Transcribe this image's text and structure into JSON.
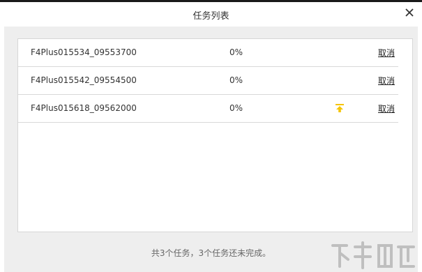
{
  "dialog": {
    "title": "任务列表",
    "footer": "共3个任务，3个任务还未完成。"
  },
  "tasks": [
    {
      "name": "F4Plus015534_09553700",
      "progress": "0%",
      "cancel_label": "取消",
      "show_top_icon": false
    },
    {
      "name": "F4Plus015542_09554500",
      "progress": "0%",
      "cancel_label": "取消",
      "show_top_icon": false
    },
    {
      "name": "F4Plus015618_09562000",
      "progress": "0%",
      "cancel_label": "取消",
      "show_top_icon": true
    }
  ],
  "colors": {
    "accent_yellow": "#f5c400",
    "row_border": "#d8d8d8",
    "body_background": "#eeeeee"
  },
  "icons": {
    "close": "close-icon",
    "pin_top": "pin-to-top-icon"
  }
}
